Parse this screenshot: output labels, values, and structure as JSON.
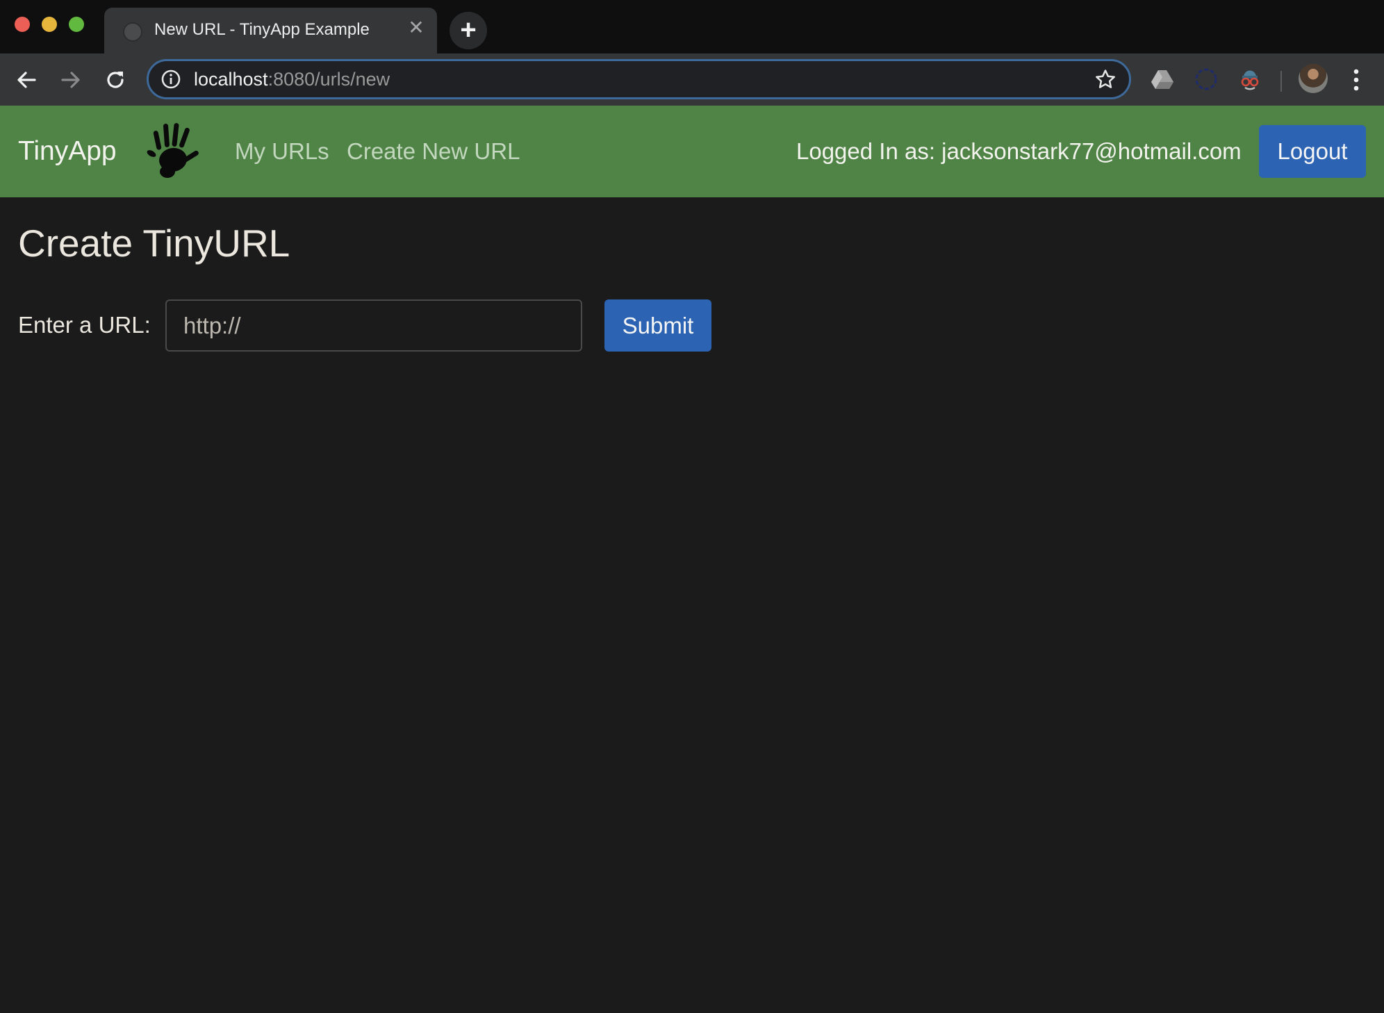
{
  "browser": {
    "tab": {
      "title": "New URL - TinyApp Example",
      "close_glyph": "✕"
    },
    "new_tab_glyph": "+",
    "address": {
      "host": "localhost",
      "path": ":8080/urls/new"
    }
  },
  "navbar": {
    "brand": "TinyApp",
    "links": [
      {
        "label": "My URLs"
      },
      {
        "label": "Create New URL"
      }
    ],
    "logged_in_text": "Logged In as: jacksonstark77@hotmail.com",
    "logout_label": "Logout",
    "color": "#508447"
  },
  "main": {
    "title": "Create TinyURL",
    "form": {
      "label": "Enter a URL:",
      "input_placeholder": "http://",
      "input_value": "",
      "submit_label": "Submit"
    }
  },
  "colors": {
    "primary_button": "#2c64b3",
    "background": "#1b1b1b"
  },
  "icons": [
    "back-arrow-icon",
    "forward-arrow-icon",
    "reload-icon",
    "info-icon",
    "star-icon",
    "google-drive-icon",
    "extension-ring-icon",
    "extension-glasses-icon",
    "profile-avatar",
    "more-menu-icon",
    "hand-print-icon"
  ]
}
